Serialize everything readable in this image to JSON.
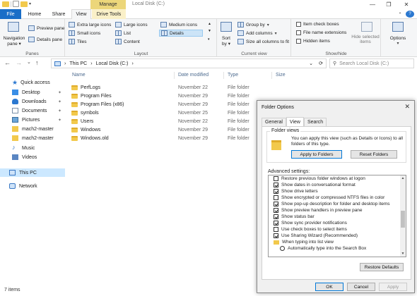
{
  "window": {
    "manage_tab": "Manage",
    "title": "Local Disk (C:)",
    "min": "—",
    "max": "❐",
    "close": "✕"
  },
  "tabs": {
    "file": "File",
    "home": "Home",
    "share": "Share",
    "view": "View",
    "drive_tools": "Drive Tools"
  },
  "ribbon": {
    "panes": {
      "label": "Panes",
      "navigation_pane": "Navigation",
      "navigation_pane2": "pane",
      "preview_pane": "Preview pane",
      "details_pane": "Details pane"
    },
    "layout": {
      "label": "Layout",
      "extra_large": "Extra large icons",
      "large": "Large icons",
      "medium": "Medium icons",
      "small": "Small icons",
      "list": "List",
      "details": "Details",
      "tiles": "Tiles",
      "content": "Content"
    },
    "current_view": {
      "label": "Current view",
      "sort_by": "Sort",
      "sort_by2": "by",
      "group_by": "Group by",
      "add_columns": "Add columns",
      "size_all": "Size all columns to fit"
    },
    "show_hide": {
      "label": "Show/hide",
      "item_check_boxes": "Item check boxes",
      "file_name_extensions": "File name extensions",
      "hidden_items": "Hidden items",
      "hide_selected": "Hide selected",
      "hide_selected2": "items"
    },
    "options": {
      "label": "Options"
    }
  },
  "address": {
    "back": "←",
    "forward": "→",
    "recent": "⌄",
    "up": "↑",
    "crumb1": "This PC",
    "crumb2": "Local Disk (C:)",
    "search_placeholder": "Search Local Disk (C:)"
  },
  "nav": [
    {
      "label": "Quick access"
    },
    {
      "label": "Desktop"
    },
    {
      "label": "Downloads"
    },
    {
      "label": "Documents"
    },
    {
      "label": "Pictures"
    },
    {
      "label": "mach2-master"
    },
    {
      "label": "mach2-master"
    },
    {
      "label": "Music"
    },
    {
      "label": "Videos"
    },
    {
      "label": "This PC"
    },
    {
      "label": "Network"
    }
  ],
  "columns": {
    "name": "Name",
    "date": "Date modified",
    "type": "Type",
    "size": "Size"
  },
  "files": [
    {
      "name": "PerfLogs",
      "date": "November 22",
      "type": "File folder"
    },
    {
      "name": "Program Files",
      "date": "November 29",
      "type": "File folder"
    },
    {
      "name": "Program Files (x86)",
      "date": "November 29",
      "type": "File folder"
    },
    {
      "name": "symbols",
      "date": "November 25",
      "type": "File folder"
    },
    {
      "name": "Users",
      "date": "November 22",
      "type": "File folder"
    },
    {
      "name": "Windows",
      "date": "November 29",
      "type": "File folder"
    },
    {
      "name": "Windows.old",
      "date": "November 29",
      "type": "File folder"
    }
  ],
  "status": {
    "count": "7 items"
  },
  "dialog": {
    "title": "Folder Options",
    "close": "✕",
    "tabs": {
      "general": "General",
      "view": "View",
      "search": "Search"
    },
    "folder_views": {
      "legend": "Folder views",
      "text": "You can apply this view (such as Details or Icons) to all folders of this type.",
      "apply": "Apply to Folders",
      "reset": "Reset Folders"
    },
    "advanced_label": "Advanced settings:",
    "advanced": [
      {
        "label": "Restore previous folder windows at logon",
        "checked": false,
        "kind": "check"
      },
      {
        "label": "Show dates in conversational format",
        "checked": true,
        "kind": "check"
      },
      {
        "label": "Show drive letters",
        "checked": true,
        "kind": "check"
      },
      {
        "label": "Show encrypted or compressed NTFS files in color",
        "checked": false,
        "kind": "check"
      },
      {
        "label": "Show pop-up description for folder and desktop items",
        "checked": true,
        "kind": "check"
      },
      {
        "label": "Show preview handlers in preview pane",
        "checked": true,
        "kind": "check"
      },
      {
        "label": "Show status bar",
        "checked": true,
        "kind": "check"
      },
      {
        "label": "Show sync provider notifications",
        "checked": true,
        "kind": "check"
      },
      {
        "label": "Use check boxes to select items",
        "checked": false,
        "kind": "check"
      },
      {
        "label": "Use Sharing Wizard (Recommended)",
        "checked": true,
        "kind": "check"
      },
      {
        "label": "When typing into list view",
        "checked": false,
        "kind": "folder"
      },
      {
        "label": "Automatically type into the Search Box",
        "checked": false,
        "kind": "radio"
      }
    ],
    "restore_defaults": "Restore Defaults",
    "ok": "OK",
    "cancel": "Cancel",
    "apply": "Apply"
  }
}
